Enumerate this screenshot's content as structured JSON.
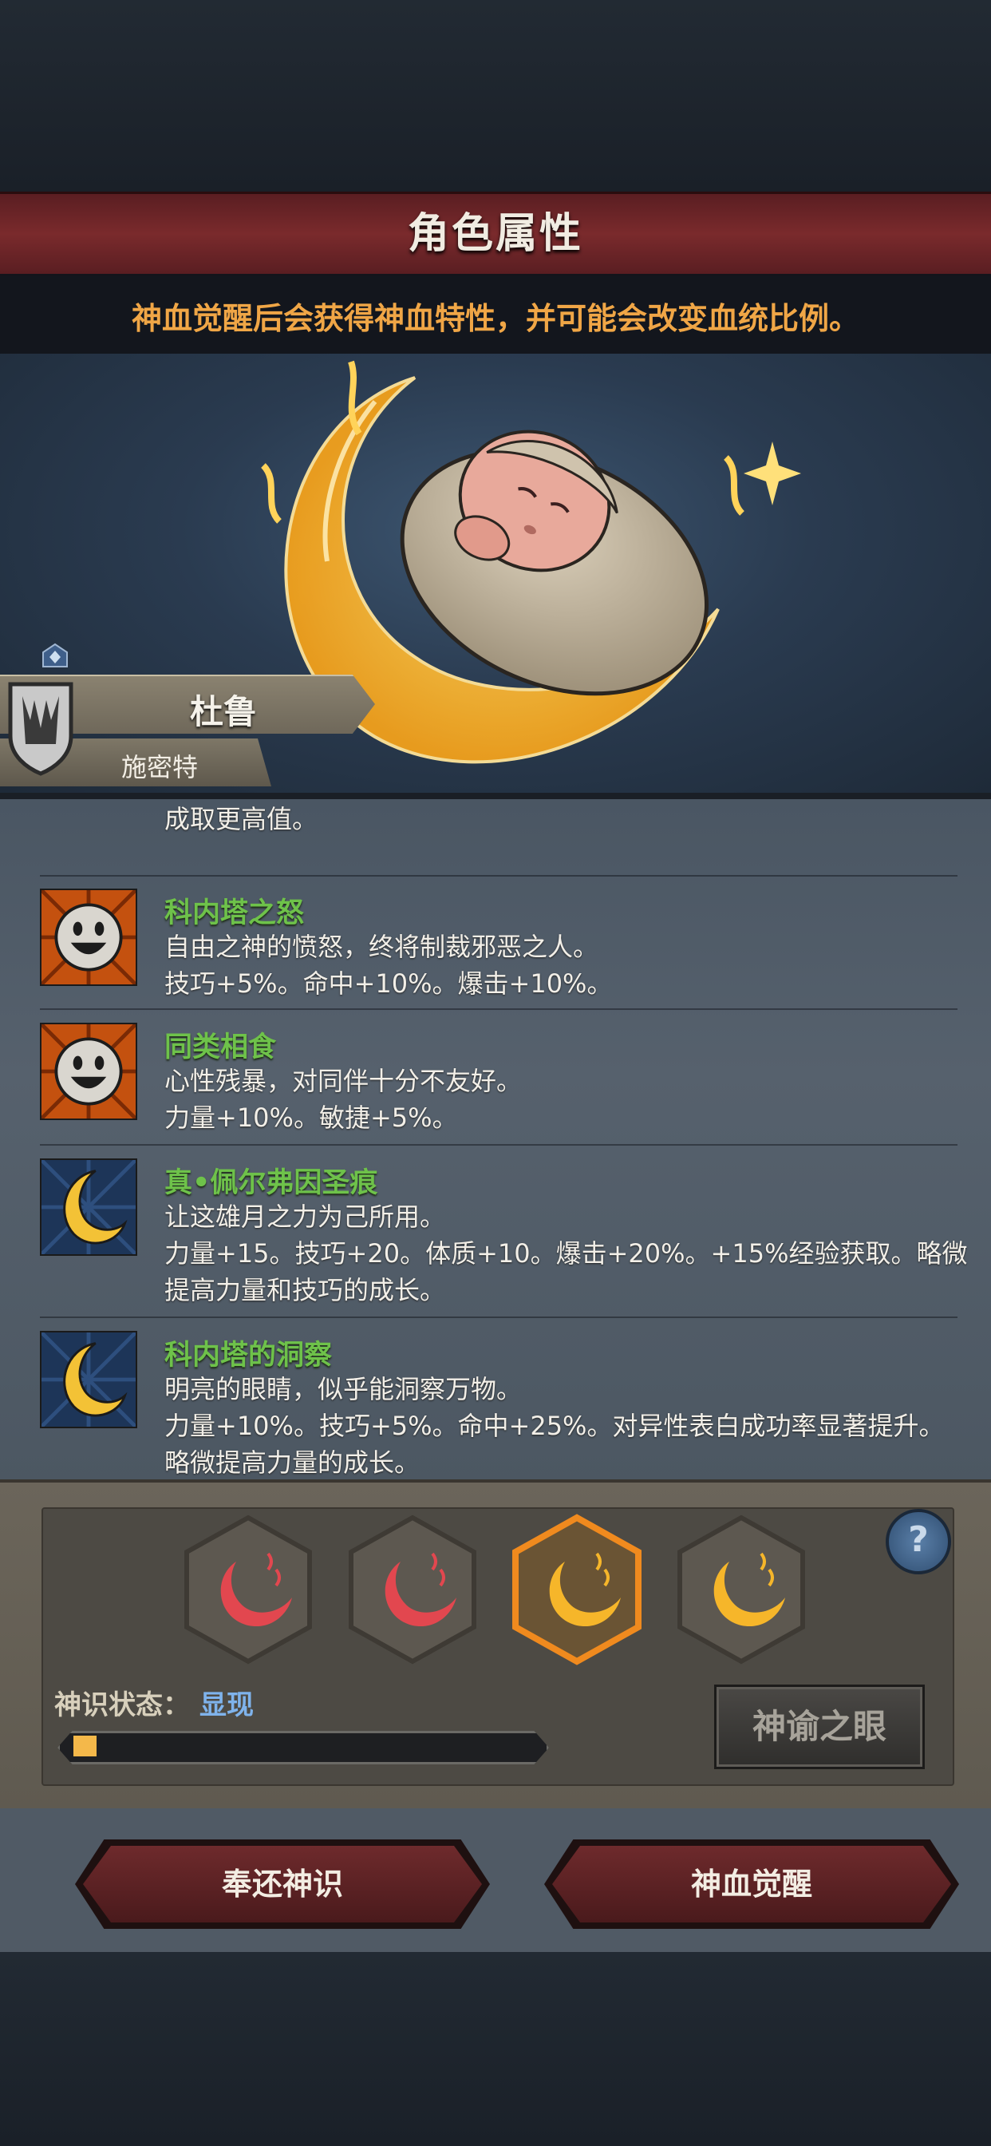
{
  "header": {
    "title": "角色属性"
  },
  "notice": {
    "text": "神血觉醒后会获得神血特性，并可能会改变血统比例。"
  },
  "character": {
    "name": "杜鲁",
    "subname": "施密特"
  },
  "traits": {
    "partial_line": "成取更高值。",
    "items": [
      {
        "name": "科内塔之怒",
        "icon": "smiling-face-icon",
        "lines": [
          "自由之神的愤怒，终将制裁邪恶之人。",
          "技巧+5%。命中+10%。爆击+10%。"
        ]
      },
      {
        "name": "同类相食",
        "icon": "smiling-face-icon",
        "lines": [
          "心性残暴，对同伴十分不友好。",
          "力量+10%。敏捷+5%。"
        ]
      },
      {
        "name": "真•佩尔弗因圣痕",
        "icon": "crescent-moon-icon",
        "lines": [
          "让这雄月之力为己所用。",
          "力量+15。技巧+20。体质+10。爆击+20%。+15%经验获取。略微",
          "提高力量和技巧的成长。"
        ]
      },
      {
        "name": "科内塔的洞察",
        "icon": "crescent-moon-icon",
        "lines": [
          "明亮的眼睛，似乎能洞察万物。",
          "力量+10%。技巧+5%。命中+25%。对异性表白成功率显著提升。",
          "略微提高力量的成长。"
        ]
      }
    ]
  },
  "awakening": {
    "slots": [
      {
        "color": "red",
        "icon": "red-crescent-icon"
      },
      {
        "color": "red",
        "icon": "red-crescent-icon"
      },
      {
        "color": "gold",
        "icon": "gold-crescent-icon",
        "selected": true
      },
      {
        "color": "gold",
        "icon": "gold-crescent-icon"
      }
    ],
    "help": "?",
    "status_label": "神识状态：",
    "status_value": "显现",
    "progress": 0.05,
    "oracle_button": "神谕之眼"
  },
  "buttons": {
    "return": "奉还神识",
    "awaken": "神血觉醒"
  },
  "colors": {
    "trait_name": "#6ec24a",
    "notice": "#f0a646",
    "status": "#7fb3ec",
    "progress": "#f4b84a"
  }
}
